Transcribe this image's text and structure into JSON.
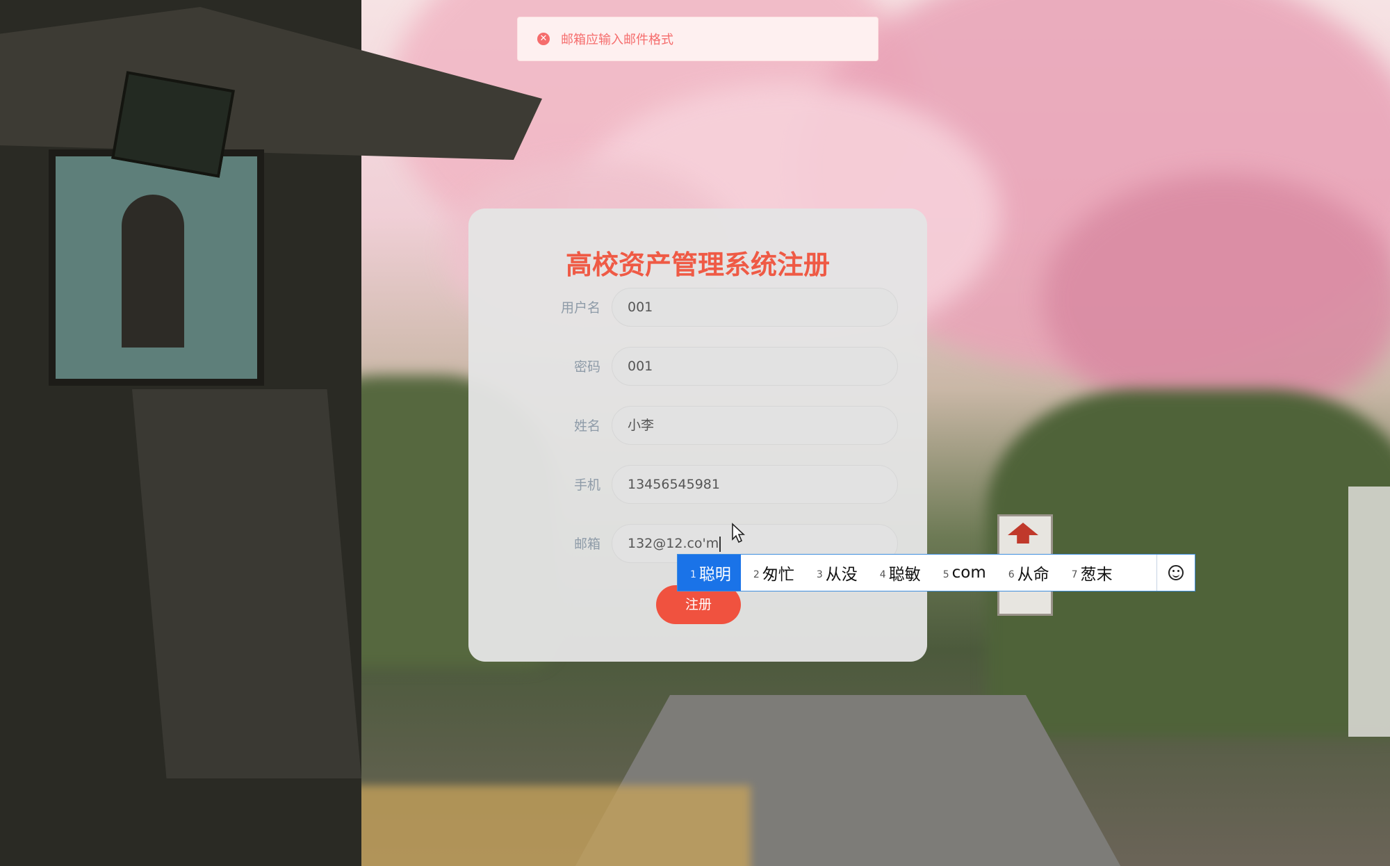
{
  "toast": {
    "type": "error",
    "icon": "error-circle-icon",
    "message": "邮箱应输入邮件格式",
    "color": "#f56c6c"
  },
  "form": {
    "title": "高校资产管理系统注册",
    "title_color": "#ef5a45",
    "fields": [
      {
        "label": "用户名",
        "value": "001"
      },
      {
        "label": "密码",
        "value": "001"
      },
      {
        "label": "姓名",
        "value": "小李"
      },
      {
        "label": "手机",
        "value": "13456545981"
      },
      {
        "label": "邮箱",
        "value": "132@12.co'm"
      }
    ],
    "submit_label": "注册",
    "submit_color": "#f0523f"
  },
  "ime": {
    "candidates": [
      {
        "num": "1",
        "text": "聪明"
      },
      {
        "num": "2",
        "text": "匆忙"
      },
      {
        "num": "3",
        "text": "从没"
      },
      {
        "num": "4",
        "text": "聪敏"
      },
      {
        "num": "5",
        "text": "com"
      },
      {
        "num": "6",
        "text": "从命"
      },
      {
        "num": "7",
        "text": "葱末"
      }
    ],
    "selected_index": 0,
    "emoji_button_icon": "smiley-icon"
  }
}
